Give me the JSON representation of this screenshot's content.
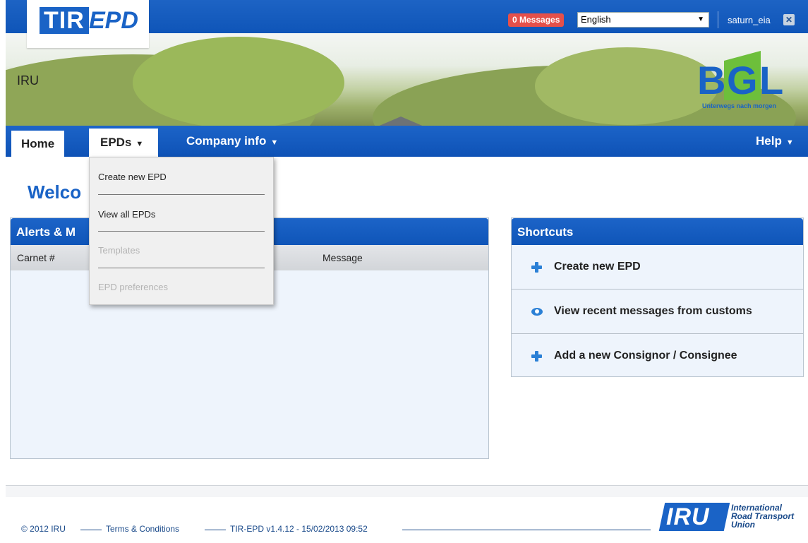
{
  "header": {
    "logo_tir": "TIR",
    "logo_epd": "EPD",
    "org_name": "IRU",
    "messages_badge": "0 Messages",
    "language": "English",
    "username": "saturn_eia",
    "bgl_b": "B",
    "bgl_g": "G",
    "bgl_l": "L",
    "bgl_tagline": "Unterwegs nach morgen"
  },
  "nav": {
    "home": "Home",
    "epds": "EPDs",
    "company_info": "Company info",
    "help": "Help"
  },
  "dropdown": {
    "items": [
      {
        "label": "Create new EPD",
        "enabled": true
      },
      {
        "label": "View all EPDs",
        "enabled": true
      },
      {
        "label": "Templates",
        "enabled": false
      },
      {
        "label": "EPD preferences",
        "enabled": false
      }
    ]
  },
  "main": {
    "welcome": "Welco",
    "alerts_title": "Alerts & M",
    "columns": [
      "Carnet #",
      "Message"
    ],
    "shortcuts_title": "Shortcuts",
    "shortcuts": [
      {
        "label": "Create new EPD",
        "icon": "plus-icon"
      },
      {
        "label": "View recent messages from customs",
        "icon": "eye-icon"
      },
      {
        "label": "Add a new Consignor / Consignee",
        "icon": "plus-icon"
      }
    ]
  },
  "footer": {
    "copyright": "© 2012 IRU",
    "terms": "Terms & Conditions",
    "version": "TIR-EPD v1.4.12 - 15/02/2013 09:52",
    "iru_logo": "IRU",
    "iru_line1": "International",
    "iru_line2": "Road Transport",
    "iru_line3": "Union"
  },
  "colors": {
    "brand_blue": "#1a63c6",
    "badge_red": "#e5504a",
    "bgl_green": "#6dbf3b"
  }
}
